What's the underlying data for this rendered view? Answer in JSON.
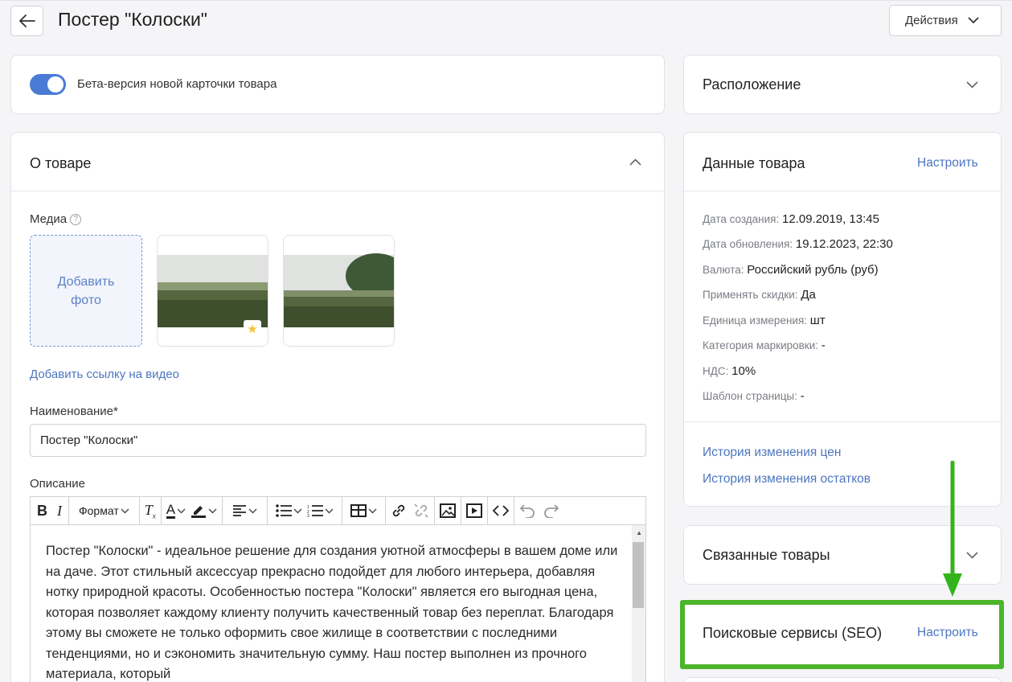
{
  "header": {
    "title": "Постер \"Колоски\"",
    "actions_label": "Действия"
  },
  "beta": {
    "label": "Бета-версия новой карточки товара",
    "enabled": true
  },
  "about": {
    "heading": "О товаре",
    "media_label": "Медиа",
    "add_photo_line1": "Добавить",
    "add_photo_line2": "фото",
    "video_link": "Добавить ссылку на видео",
    "name_label": "Наименование*",
    "name_value": "Постер \"Колоски\"",
    "description_label": "Описание",
    "format_label": "Формат",
    "description_text": "Постер \"Колоски\" - идеальное решение для создания уютной атмосферы в вашем доме или на даче. Этот стильный аксессуар прекрасно подойдет для любого интерьера, добавляя нотку природной красоты. Особенностью постера \"Колоски\" является его выгодная цена, которая позволяет каждому клиенту получить качественный товар без переплат. Благодаря этому вы сможете не только оформить свое жилище в соответствии с последними тенденциями, но и сэкономить значительную сумму. Наш постер выполнен из прочного материала, который"
  },
  "location": {
    "heading": "Расположение"
  },
  "product_data": {
    "heading": "Данные товара",
    "configure_label": "Настроить",
    "rows": [
      {
        "label": "Дата создания:",
        "value": "12.09.2019, 13:45"
      },
      {
        "label": "Дата обновления:",
        "value": "19.12.2023, 22:30"
      },
      {
        "label": "Валюта:",
        "value": "Российский рубль (руб)"
      },
      {
        "label": "Применять скидки:",
        "value": "Да"
      },
      {
        "label": "Единица измерения:",
        "value": "шт"
      },
      {
        "label": "Категория маркировки:",
        "value": "-"
      },
      {
        "label": "НДС:",
        "value": "10%"
      },
      {
        "label": "Шаблон страницы:",
        "value": "-"
      }
    ],
    "price_history_link": "История изменения цен",
    "stock_history_link": "История изменения остатков"
  },
  "related": {
    "heading": "Связанные товары"
  },
  "seo": {
    "heading": "Поисковые сервисы (SEO)",
    "configure_label": "Настроить"
  },
  "colors": {
    "accent": "#4a7cd6",
    "link": "#4d76bf",
    "highlight": "#4cb52a"
  }
}
